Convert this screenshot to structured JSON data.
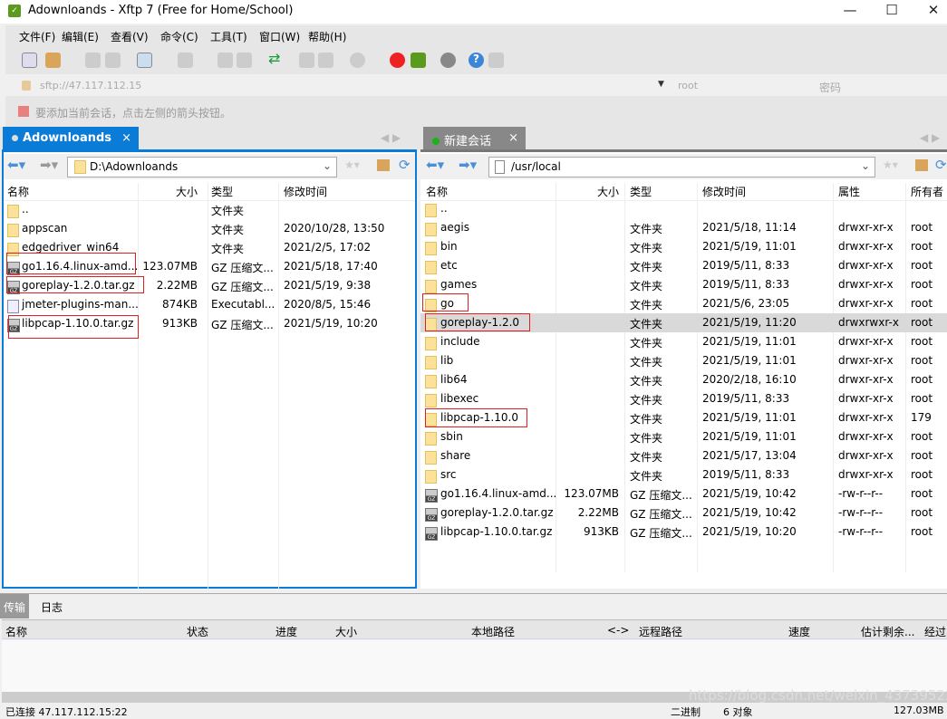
{
  "window": {
    "title": "Adownloands - Xftp 7 (Free for Home/School)",
    "minimize": "—",
    "maximize": "☐",
    "close": "✕"
  },
  "menu": [
    "文件(F)",
    "编辑(E)",
    "查看(V)",
    "命令(C)",
    "工具(T)",
    "窗口(W)",
    "帮助(H)"
  ],
  "address": {
    "url": "sftp://47.117.112.15",
    "user": "root",
    "password_placeholder": "密码"
  },
  "hint": "要添加当前会话，点击左侧的箭头按钮。",
  "tabs": {
    "local": "Adownloands",
    "remote": "新建会话",
    "close": "×"
  },
  "local": {
    "path": "D:\\Adownloands",
    "columns": [
      "名称",
      "大小",
      "类型",
      "修改时间"
    ],
    "rows": [
      {
        "icon": "folder",
        "name": "..",
        "size": "",
        "type": "文件夹",
        "date": ""
      },
      {
        "icon": "folder",
        "name": "appscan",
        "size": "",
        "type": "文件夹",
        "date": "2020/10/28, 13:50"
      },
      {
        "icon": "folder",
        "name": "edgedriver_win64",
        "size": "",
        "type": "文件夹",
        "date": "2021/2/5, 17:02"
      },
      {
        "icon": "gz",
        "name": "go1.16.4.linux-amd...",
        "size": "123.07MB",
        "type": "GZ 压缩文...",
        "date": "2021/5/18, 17:40"
      },
      {
        "icon": "gz",
        "name": "goreplay-1.2.0.tar.gz",
        "size": "2.22MB",
        "type": "GZ 压缩文...",
        "date": "2021/5/19, 9:38"
      },
      {
        "icon": "jar",
        "name": "jmeter-plugins-man...",
        "size": "874KB",
        "type": "Executabl...",
        "date": "2020/8/5, 15:46"
      },
      {
        "icon": "gz",
        "name": "libpcap-1.10.0.tar.gz",
        "size": "913KB",
        "type": "GZ 压缩文...",
        "date": "2021/5/19, 10:20"
      }
    ]
  },
  "remote": {
    "path": "/usr/local",
    "columns": [
      "名称",
      "大小",
      "类型",
      "修改时间",
      "属性",
      "所有者"
    ],
    "rows": [
      {
        "icon": "folder",
        "name": "..",
        "size": "",
        "type": "",
        "date": "",
        "attr": "",
        "owner": ""
      },
      {
        "icon": "folder",
        "name": "aegis",
        "size": "",
        "type": "文件夹",
        "date": "2021/5/18, 11:14",
        "attr": "drwxr-xr-x",
        "owner": "root"
      },
      {
        "icon": "folder",
        "name": "bin",
        "size": "",
        "type": "文件夹",
        "date": "2021/5/19, 11:01",
        "attr": "drwxr-xr-x",
        "owner": "root"
      },
      {
        "icon": "folder",
        "name": "etc",
        "size": "",
        "type": "文件夹",
        "date": "2019/5/11, 8:33",
        "attr": "drwxr-xr-x",
        "owner": "root"
      },
      {
        "icon": "folder",
        "name": "games",
        "size": "",
        "type": "文件夹",
        "date": "2019/5/11, 8:33",
        "attr": "drwxr-xr-x",
        "owner": "root"
      },
      {
        "icon": "folder",
        "name": "go",
        "size": "",
        "type": "文件夹",
        "date": "2021/5/6, 23:05",
        "attr": "drwxr-xr-x",
        "owner": "root"
      },
      {
        "icon": "folder",
        "name": "goreplay-1.2.0",
        "size": "",
        "type": "文件夹",
        "date": "2021/5/19, 11:20",
        "attr": "drwxrwxr-x",
        "owner": "root"
      },
      {
        "icon": "folder",
        "name": "include",
        "size": "",
        "type": "文件夹",
        "date": "2021/5/19, 11:01",
        "attr": "drwxr-xr-x",
        "owner": "root"
      },
      {
        "icon": "folder",
        "name": "lib",
        "size": "",
        "type": "文件夹",
        "date": "2021/5/19, 11:01",
        "attr": "drwxr-xr-x",
        "owner": "root"
      },
      {
        "icon": "folder",
        "name": "lib64",
        "size": "",
        "type": "文件夹",
        "date": "2020/2/18, 16:10",
        "attr": "drwxr-xr-x",
        "owner": "root"
      },
      {
        "icon": "folder",
        "name": "libexec",
        "size": "",
        "type": "文件夹",
        "date": "2019/5/11, 8:33",
        "attr": "drwxr-xr-x",
        "owner": "root"
      },
      {
        "icon": "folder",
        "name": "libpcap-1.10.0",
        "size": "",
        "type": "文件夹",
        "date": "2021/5/19, 11:01",
        "attr": "drwxr-xr-x",
        "owner": "179"
      },
      {
        "icon": "folder",
        "name": "sbin",
        "size": "",
        "type": "文件夹",
        "date": "2021/5/19, 11:01",
        "attr": "drwxr-xr-x",
        "owner": "root"
      },
      {
        "icon": "folder",
        "name": "share",
        "size": "",
        "type": "文件夹",
        "date": "2021/5/17, 13:04",
        "attr": "drwxr-xr-x",
        "owner": "root"
      },
      {
        "icon": "folder",
        "name": "src",
        "size": "",
        "type": "文件夹",
        "date": "2019/5/11, 8:33",
        "attr": "drwxr-xr-x",
        "owner": "root"
      },
      {
        "icon": "gz",
        "name": "go1.16.4.linux-amd...",
        "size": "123.07MB",
        "type": "GZ 压缩文...",
        "date": "2021/5/19, 10:42",
        "attr": "-rw-r--r--",
        "owner": "root"
      },
      {
        "icon": "gz",
        "name": "goreplay-1.2.0.tar.gz",
        "size": "2.22MB",
        "type": "GZ 压缩文...",
        "date": "2021/5/19, 10:42",
        "attr": "-rw-r--r--",
        "owner": "root"
      },
      {
        "icon": "gz",
        "name": "libpcap-1.10.0.tar.gz",
        "size": "913KB",
        "type": "GZ 压缩文...",
        "date": "2021/5/19, 10:20",
        "attr": "-rw-r--r--",
        "owner": "root"
      }
    ]
  },
  "transfer": {
    "tabs": [
      "传输",
      "日志"
    ],
    "columns": [
      "名称",
      "状态",
      "进度",
      "大小",
      "本地路径",
      "<->",
      "远程路径",
      "速度",
      "估计剩余...",
      "经过"
    ]
  },
  "status": {
    "connection": "已连接 47.117.112.15:22",
    "mode": "二进制",
    "objects": "6 对象",
    "size": "127.03MB"
  },
  "watermark": "https://blog.csdn.net/weixin_43739522",
  "colors": {
    "accent": "#0a7bd6",
    "highlight": "#e02020"
  }
}
